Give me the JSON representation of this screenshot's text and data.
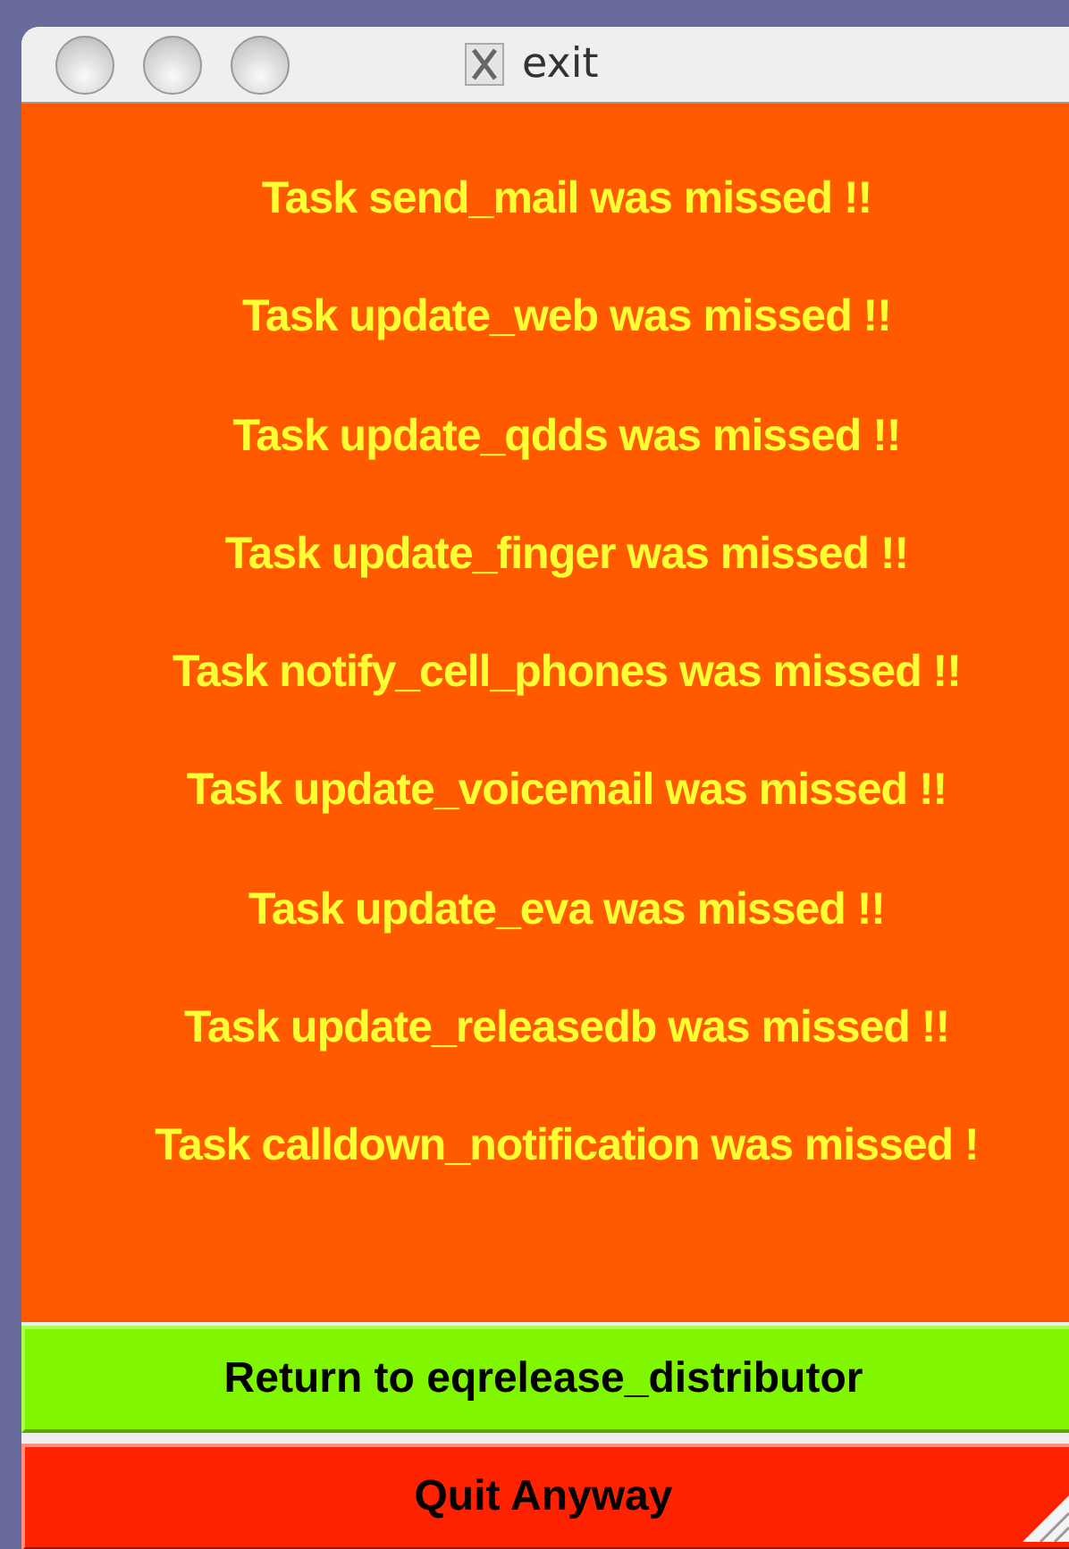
{
  "window": {
    "title": "exit"
  },
  "messages": [
    "Task send_mail was missed !!",
    "Task update_web was missed !!",
    "Task update_qdds was missed !!",
    "Task update_finger was missed !!",
    "Task notify_cell_phones was missed !!",
    "Task update_voicemail was missed !!",
    "Task update_eva was missed !!",
    "Task update_releasedb was missed !!",
    "Task calldown_notification was missed !"
  ],
  "buttons": [
    {
      "label": "Return to eqrelease_distributor",
      "kind": "return"
    },
    {
      "label": "Quit Anyway",
      "kind": "quit"
    }
  ]
}
